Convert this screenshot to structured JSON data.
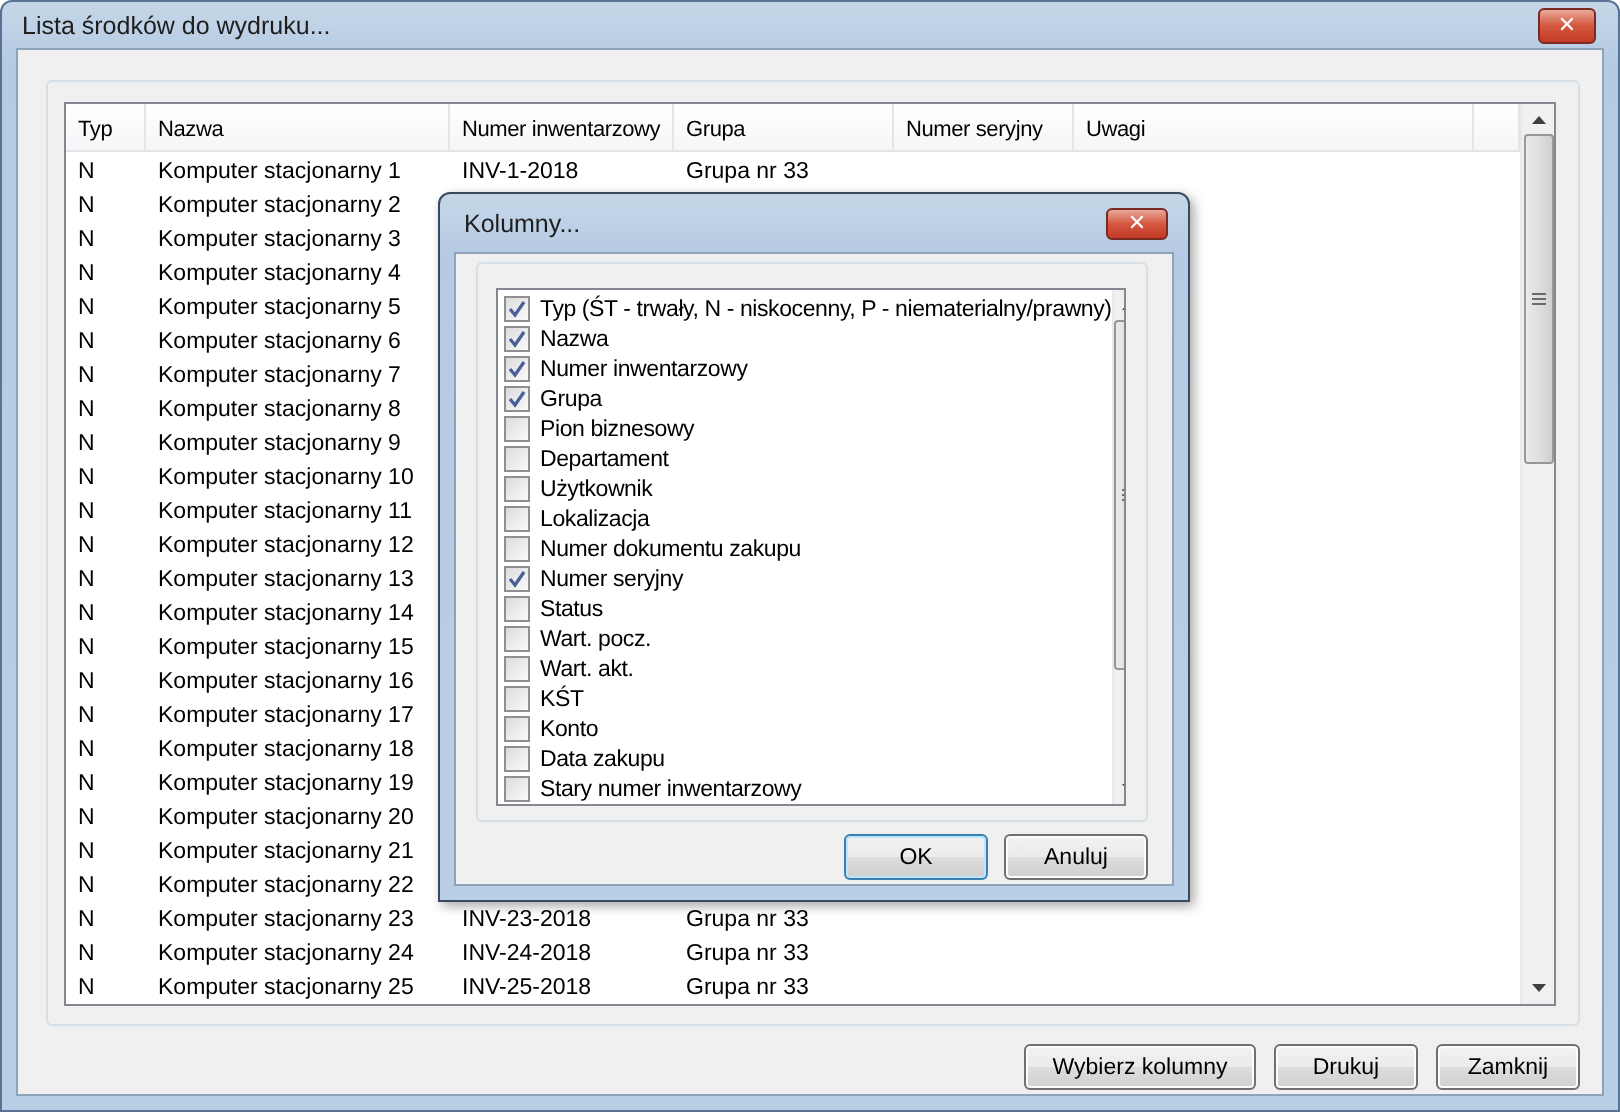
{
  "window": {
    "title": "Lista środków do wydruku...",
    "close": "✕"
  },
  "table": {
    "columns": [
      "Typ",
      "Nazwa",
      "Numer inwentarzowy",
      "Grupa",
      "Numer seryjny",
      "Uwagi"
    ],
    "rows": [
      {
        "typ": "N",
        "nazwa": "Komputer stacjonarny 1",
        "numer": "INV-1-2018",
        "grupa": "Grupa nr 33"
      },
      {
        "typ": "N",
        "nazwa": "Komputer stacjonarny 2"
      },
      {
        "typ": "N",
        "nazwa": "Komputer stacjonarny 3"
      },
      {
        "typ": "N",
        "nazwa": "Komputer stacjonarny 4"
      },
      {
        "typ": "N",
        "nazwa": "Komputer stacjonarny 5"
      },
      {
        "typ": "N",
        "nazwa": "Komputer stacjonarny 6"
      },
      {
        "typ": "N",
        "nazwa": "Komputer stacjonarny 7"
      },
      {
        "typ": "N",
        "nazwa": "Komputer stacjonarny 8"
      },
      {
        "typ": "N",
        "nazwa": "Komputer stacjonarny 9"
      },
      {
        "typ": "N",
        "nazwa": "Komputer stacjonarny 10"
      },
      {
        "typ": "N",
        "nazwa": "Komputer stacjonarny 11"
      },
      {
        "typ": "N",
        "nazwa": "Komputer stacjonarny 12"
      },
      {
        "typ": "N",
        "nazwa": "Komputer stacjonarny 13"
      },
      {
        "typ": "N",
        "nazwa": "Komputer stacjonarny 14"
      },
      {
        "typ": "N",
        "nazwa": "Komputer stacjonarny 15"
      },
      {
        "typ": "N",
        "nazwa": "Komputer stacjonarny 16"
      },
      {
        "typ": "N",
        "nazwa": "Komputer stacjonarny 17"
      },
      {
        "typ": "N",
        "nazwa": "Komputer stacjonarny 18"
      },
      {
        "typ": "N",
        "nazwa": "Komputer stacjonarny 19"
      },
      {
        "typ": "N",
        "nazwa": "Komputer stacjonarny 20"
      },
      {
        "typ": "N",
        "nazwa": "Komputer stacjonarny 21"
      },
      {
        "typ": "N",
        "nazwa": "Komputer stacjonarny 22"
      },
      {
        "typ": "N",
        "nazwa": "Komputer stacjonarny 23",
        "numer": "INV-23-2018",
        "grupa": "Grupa nr 33"
      },
      {
        "typ": "N",
        "nazwa": "Komputer stacjonarny 24",
        "numer": "INV-24-2018",
        "grupa": "Grupa nr 33"
      },
      {
        "typ": "N",
        "nazwa": "Komputer stacjonarny 25",
        "numer": "INV-25-2018",
        "grupa": "Grupa nr 33"
      }
    ]
  },
  "buttons": [
    "Wybierz kolumny",
    "Drukuj",
    "Zamknij"
  ],
  "dialog": {
    "title": "Kolumny...",
    "close": "✕",
    "items": [
      {
        "label": "Typ (ŚT - trwały, N - niskocenny, P - niematerialny/prawny)",
        "checked": true
      },
      {
        "label": "Nazwa",
        "checked": true
      },
      {
        "label": "Numer inwentarzowy",
        "checked": true
      },
      {
        "label": "Grupa",
        "checked": true
      },
      {
        "label": "Pion biznesowy",
        "checked": false
      },
      {
        "label": "Departament",
        "checked": false
      },
      {
        "label": "Użytkownik",
        "checked": false
      },
      {
        "label": "Lokalizacja",
        "checked": false
      },
      {
        "label": "Numer dokumentu zakupu",
        "checked": false
      },
      {
        "label": "Numer seryjny",
        "checked": true
      },
      {
        "label": "Status",
        "checked": false
      },
      {
        "label": "Wart. pocz.",
        "checked": false
      },
      {
        "label": "Wart. akt.",
        "checked": false
      },
      {
        "label": "KŚT",
        "checked": false
      },
      {
        "label": "Konto",
        "checked": false
      },
      {
        "label": "Data zakupu",
        "checked": false
      },
      {
        "label": "Stary numer inwentarzowy",
        "checked": false
      }
    ],
    "buttons": [
      {
        "label": "OK",
        "default": true
      },
      {
        "label": "Anuluj",
        "default": false
      }
    ]
  }
}
